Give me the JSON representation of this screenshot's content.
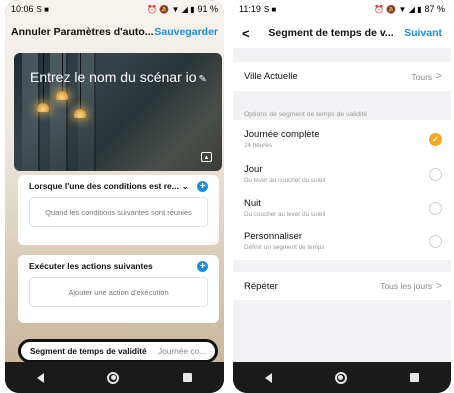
{
  "left": {
    "status": {
      "time": "10:06",
      "icons_left": "S ■",
      "icons_right": "⏰ 🔕 ▼ ◢ ▮",
      "battery": "91 %"
    },
    "header": {
      "cancel_title": "Annuler Paramètres d'auto...",
      "save": "Sauvegarder"
    },
    "hero": {
      "name_placeholder": "Entrez le nom du scénar io"
    },
    "conditions": {
      "title": "Lorsque l'une des conditions est re...",
      "placeholder": "Quand les conditions suivantes sont réunies"
    },
    "actions": {
      "title": "Exécuter les actions suivantes",
      "placeholder": "Ajouter une action d'exécution"
    },
    "validity": {
      "label": "Segment de temps de validité",
      "value": "Journée co..."
    }
  },
  "right": {
    "status": {
      "time": "11:19",
      "icons_left": "S ■",
      "icons_right": "⏰ 🔕 ▼ ◢ ▮",
      "battery": "87 %"
    },
    "header": {
      "title": "Segment de temps de v...",
      "next": "Suivant"
    },
    "city": {
      "label": "Ville Actuelle",
      "value": "Tours"
    },
    "section_label": "Options de segment de temps de validité",
    "options": [
      {
        "title": "Journée complète",
        "subtitle": "24 heures",
        "selected": true
      },
      {
        "title": "Jour",
        "subtitle": "Du lever au coucher du soleil",
        "selected": false
      },
      {
        "title": "Nuit",
        "subtitle": "Du coucher au lever du soleil",
        "selected": false
      },
      {
        "title": "Personnaliser",
        "subtitle": "Définir un segment de temps",
        "selected": false
      }
    ],
    "repeat": {
      "label": "Répéter",
      "value": "Tous les jours"
    }
  },
  "colors": {
    "accent_blue": "#1a8fd8",
    "check_orange": "#f5a623"
  },
  "icons": [
    "back-chevron-icon",
    "pencil-icon",
    "image-icon",
    "plus-icon",
    "chevron-down-icon",
    "chevron-right-icon",
    "check-icon",
    "nav-back-icon",
    "nav-home-icon",
    "nav-recents-icon"
  ]
}
